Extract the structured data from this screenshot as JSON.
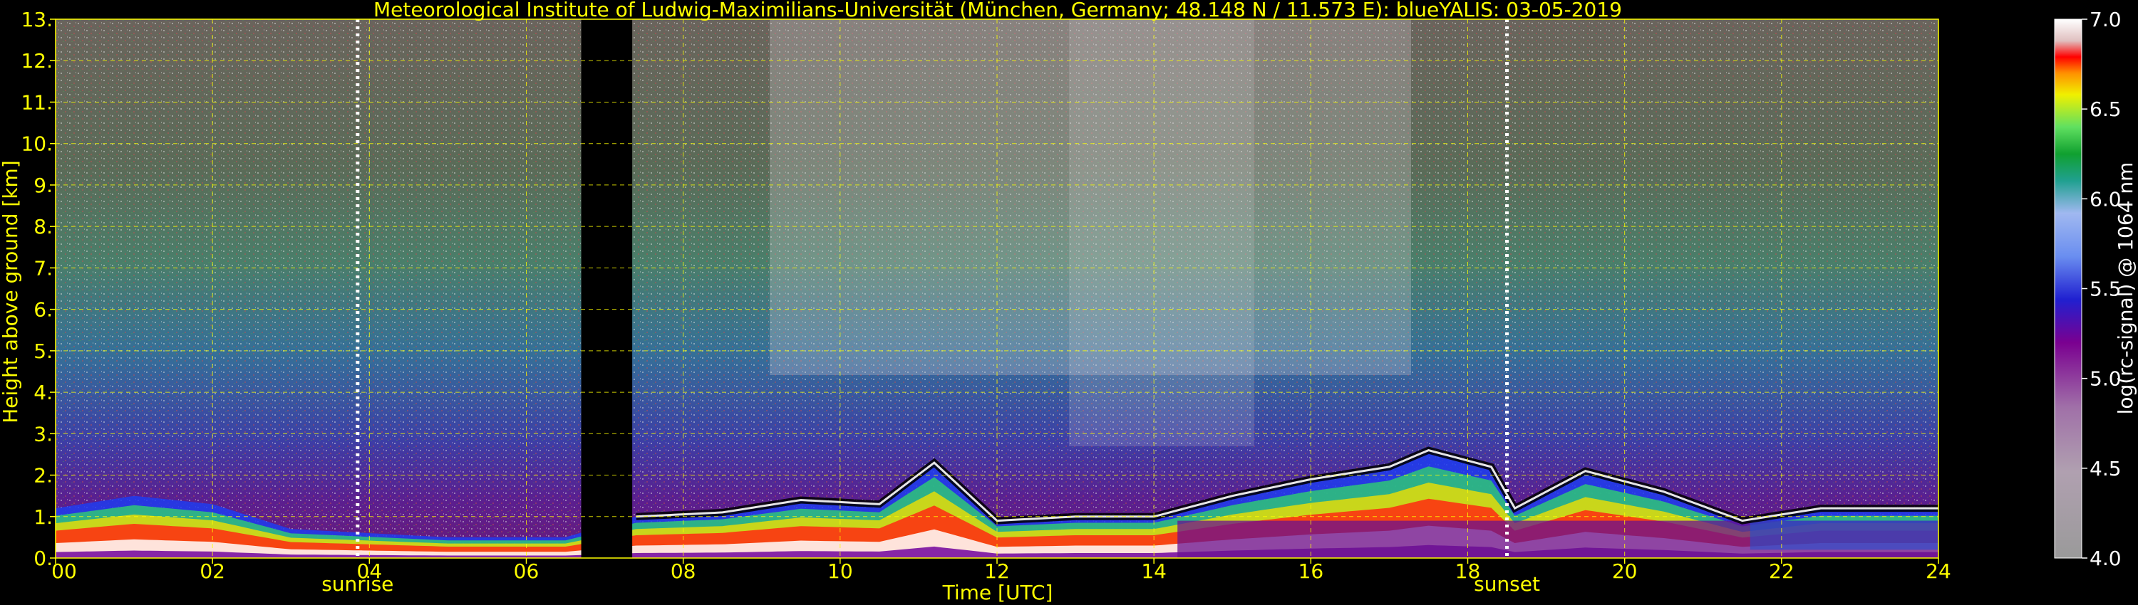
{
  "chart_data": {
    "type": "heatmap",
    "title": "Meteorological Institute of Ludwig-Maximilians-Universität (München, Germany; 48.148 N / 11.573 E):    blueYALIS: 03-05-2019",
    "xlabel": "Time [UTC]",
    "ylabel": "Height above ground [km]",
    "xlim": [
      0,
      24
    ],
    "ylim": [
      0,
      13
    ],
    "x_ticks": [
      "00",
      "02",
      "04",
      "06",
      "08",
      "10",
      "12",
      "14",
      "16",
      "18",
      "20",
      "22",
      "24"
    ],
    "y_ticks": [
      "0.",
      "1.",
      "2.",
      "3.",
      "4.",
      "5.",
      "6.",
      "7.",
      "8.",
      "9.",
      "10.",
      "11.",
      "12.",
      "13."
    ],
    "grid": true,
    "annotations": [
      {
        "label": "sunrise",
        "time": 3.85
      },
      {
        "label": "sunset",
        "time": 18.5
      }
    ],
    "no_data_gap": [
      6.7,
      7.35
    ],
    "boundary_layer_top_km": [
      [
        0.0,
        1.2
      ],
      [
        1.0,
        1.5
      ],
      [
        2.0,
        1.3
      ],
      [
        3.0,
        0.7
      ],
      [
        4.0,
        0.6
      ],
      [
        5.0,
        0.5
      ],
      [
        6.5,
        0.5
      ],
      [
        7.4,
        1.0
      ],
      [
        8.5,
        1.1
      ],
      [
        9.5,
        1.4
      ],
      [
        10.5,
        1.3
      ],
      [
        11.2,
        2.3
      ],
      [
        12.0,
        0.9
      ],
      [
        13.0,
        1.0
      ],
      [
        14.0,
        1.0
      ],
      [
        15.0,
        1.5
      ],
      [
        16.0,
        1.9
      ],
      [
        17.0,
        2.2
      ],
      [
        17.5,
        2.6
      ],
      [
        18.3,
        2.2
      ],
      [
        18.6,
        1.2
      ],
      [
        19.5,
        2.1
      ],
      [
        20.5,
        1.6
      ],
      [
        21.5,
        0.9
      ],
      [
        22.5,
        1.2
      ],
      [
        24.0,
        1.2
      ]
    ],
    "colorbar": {
      "label": "log(rc-signal) @ 1064 nm",
      "range": [
        4.0,
        7.0
      ],
      "ticks": [
        "4.0",
        "4.5",
        "5.0",
        "5.5",
        "6.0",
        "6.5",
        "7.0"
      ]
    }
  }
}
